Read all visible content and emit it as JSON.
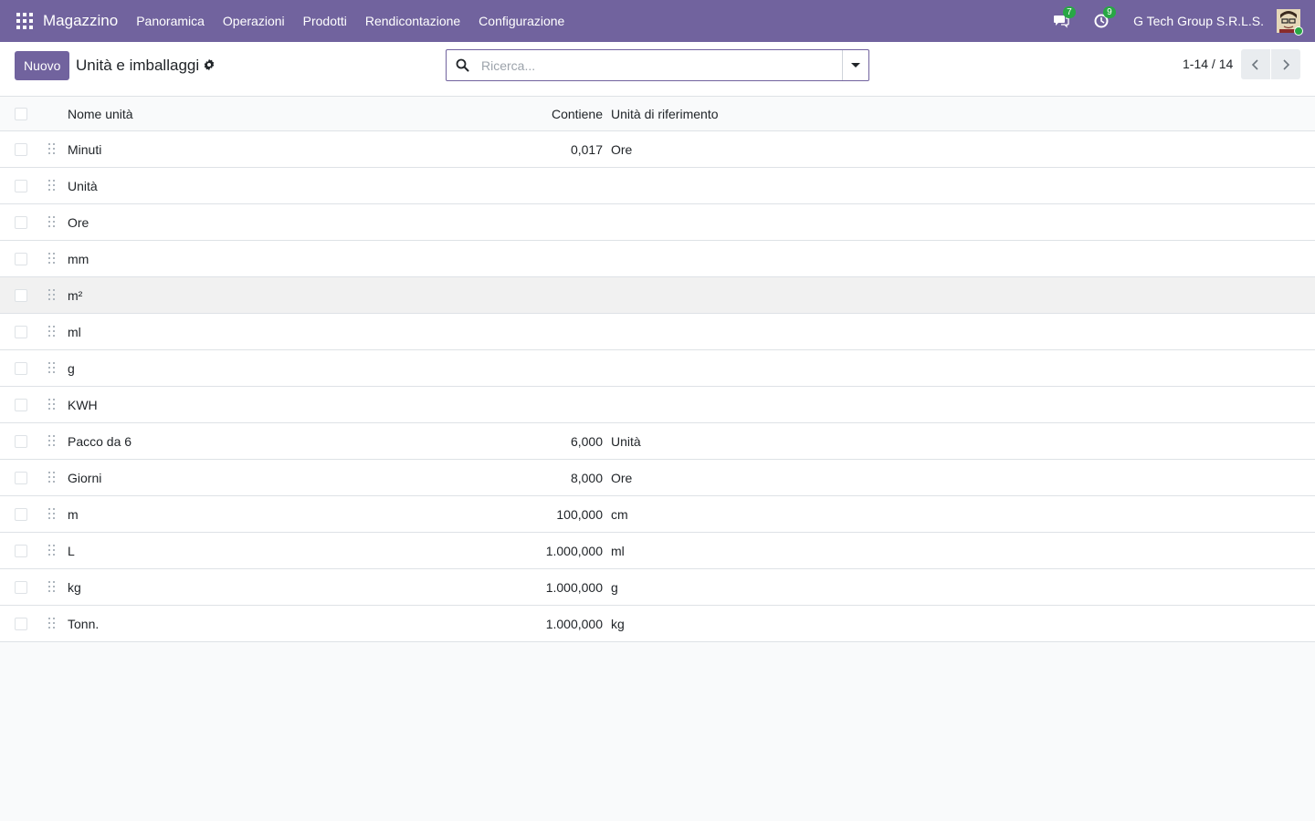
{
  "nav": {
    "brand": "Magazzino",
    "menu": [
      "Panoramica",
      "Operazioni",
      "Prodotti",
      "Rendicontazione",
      "Configurazione"
    ],
    "messages_count": "7",
    "activities_count": "9",
    "company": "G Tech Group S.R.L.S.",
    "accent_color": "#71639e",
    "badge_color": "#28a745"
  },
  "control": {
    "new_label": "Nuovo",
    "title": "Unità e imballaggi",
    "search_placeholder": "Ricerca...",
    "pager": "1-14 / 14"
  },
  "table": {
    "columns": {
      "name": "Nome unità",
      "contains": "Contiene",
      "reference": "Unità di riferimento"
    },
    "rows": [
      {
        "name": "Minuti",
        "contains": "0,017",
        "reference": "Ore"
      },
      {
        "name": "Unità",
        "contains": "",
        "reference": ""
      },
      {
        "name": "Ore",
        "contains": "",
        "reference": ""
      },
      {
        "name": "mm",
        "contains": "",
        "reference": ""
      },
      {
        "name": "m²",
        "contains": "",
        "reference": ""
      },
      {
        "name": "ml",
        "contains": "",
        "reference": ""
      },
      {
        "name": "g",
        "contains": "",
        "reference": ""
      },
      {
        "name": "KWH",
        "contains": "",
        "reference": ""
      },
      {
        "name": "Pacco da 6",
        "contains": "6,000",
        "reference": "Unità"
      },
      {
        "name": "Giorni",
        "contains": "8,000",
        "reference": "Ore"
      },
      {
        "name": "m",
        "contains": "100,000",
        "reference": "cm"
      },
      {
        "name": "L",
        "contains": "1.000,000",
        "reference": "ml"
      },
      {
        "name": "kg",
        "contains": "1.000,000",
        "reference": "g"
      },
      {
        "name": "Tonn.",
        "contains": "1.000,000",
        "reference": "kg"
      }
    ]
  },
  "icons": {
    "apps": "apps-grid-icon",
    "messages": "chat-icon",
    "activities": "clock-icon",
    "gear": "gear-icon",
    "search": "search-icon",
    "dropdown": "caret-down-icon",
    "prev": "chevron-left-icon",
    "next": "chevron-right-icon",
    "drag": "drag-handle-icon"
  }
}
